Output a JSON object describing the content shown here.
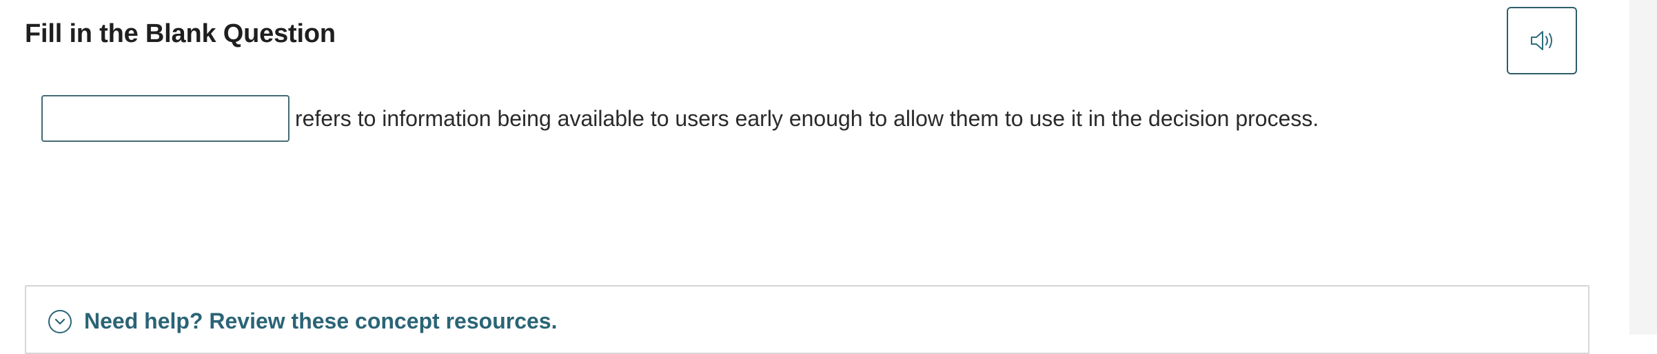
{
  "header": {
    "title": "Fill in the Blank Question",
    "audio_icon": "speaker-volume-icon"
  },
  "question": {
    "blank_value": "",
    "blank_placeholder": "",
    "text": "refers to information being available to users early enough to allow them to use it in the decision process."
  },
  "help": {
    "toggle_icon": "chevron-down-circle-icon",
    "label": "Need help? Review these concept resources."
  },
  "colors": {
    "accent": "#2a6476",
    "border": "#456a74",
    "panel_border": "#d6d6d6",
    "gutter": "#f4f4f4"
  }
}
